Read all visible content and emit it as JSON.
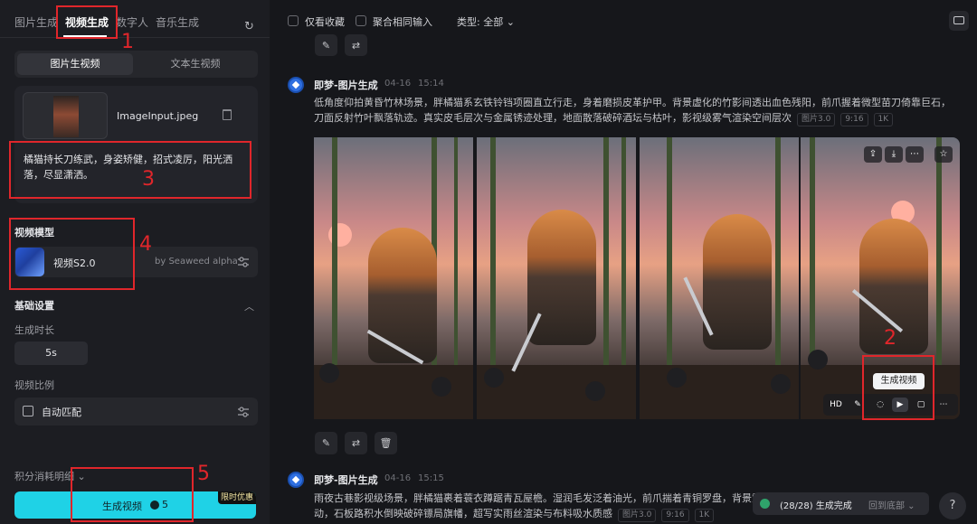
{
  "left_panel": {
    "tabs": [
      "图片生成",
      "视频生成",
      "数字人",
      "音乐生成"
    ],
    "active_tab": "视频生成",
    "segmented": {
      "image_to_video": "图片生视频",
      "text_to_video": "文本生视频"
    },
    "upload": {
      "filename": "ImageInput.jpeg"
    },
    "prompt": "橘猫持长刀练武，身姿矫健，招式凌厉，阳光洒落，尽显潇洒。",
    "model_section_label": "视频模型",
    "model": {
      "name": "视频S2.0",
      "by": "by Seaweed alpha"
    },
    "basic_settings_label": "基础设置",
    "duration_label": "生成时长",
    "duration_value": "5s",
    "ratio_label": "视频比例",
    "ratio_value": "自动匹配",
    "credits_label": "积分消耗明细",
    "generate_button": {
      "label": "生成视频",
      "cost": "5",
      "promo_badge": "限时优惠"
    }
  },
  "annotations": [
    "1",
    "2",
    "3",
    "4",
    "5"
  ],
  "top_bar": {
    "favorites_only": "仅看收藏",
    "merge_same_input": "聚合相同输入",
    "type_filter": "类型: 全部"
  },
  "feed": [
    {
      "sender": "即梦-图片生成",
      "date": "04-16",
      "time": "15:14",
      "description": "低角度仰拍黄昏竹林场景，胖橘猫系玄铁铃铛项圈直立行走，身着磨损皮革护甲。背景虚化的竹影间透出血色残阳，前爪握着微型苗刀倚靠巨石，刀面反射竹叶飘落轨迹。真实皮毛层次与金属锈迹处理，地面散落破碎酒坛与枯叶，影视级雾气渲染空间层次",
      "tags": [
        "图片3.0",
        "9:16",
        "1K"
      ]
    },
    {
      "sender": "即梦-图片生成",
      "date": "04-16",
      "time": "15:15",
      "description_line1": "雨夜古巷影视级场景，胖橘猫裹着蓑衣蹲踞青瓦屋檐。湿润毛发泛着油光，前爪揣着青铜罗盘，背景霓",
      "description_line2": "动，石板路积水倒映破碎镖局旗幡，超写实雨丝渲染与布料吸水质感",
      "tags": [
        "图片3.0",
        "9:16",
        "1K"
      ]
    }
  ],
  "image_tools": {
    "hd_label": "HD",
    "tooltip": "生成视频"
  },
  "status_bar": {
    "progress_text": "(28/28) 生成完成",
    "back_to_bottom": "回到底部"
  },
  "help_label": "?",
  "colors": {
    "accent": "#1fd2e6",
    "annotation_red": "#e0262b",
    "background": "#16171b",
    "panel": "#1c1d22"
  }
}
